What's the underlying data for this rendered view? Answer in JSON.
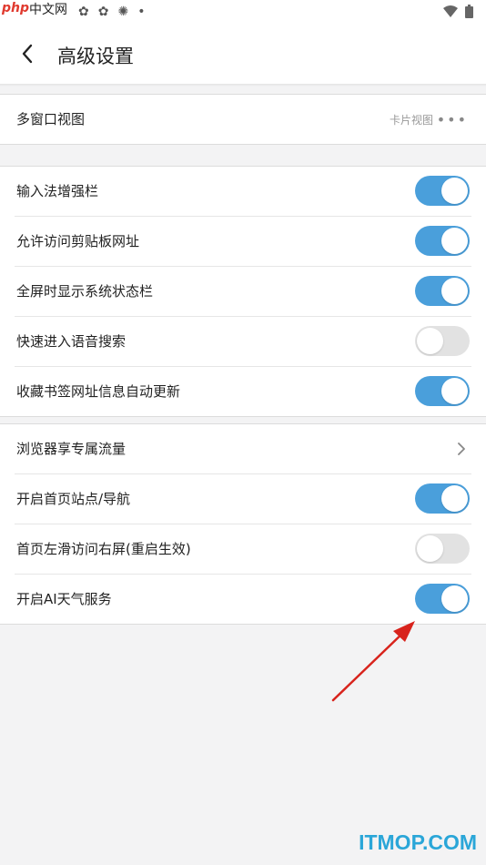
{
  "watermark": {
    "php": "php",
    "cn": "中文网",
    "bottom": "ITMOP.COM"
  },
  "header": {
    "title": "高级设置"
  },
  "section1": {
    "multi_window": {
      "label": "多窗口视图",
      "value": "卡片视图"
    }
  },
  "section2": {
    "items": [
      {
        "label": "输入法增强栏",
        "on": true
      },
      {
        "label": "允许访问剪贴板网址",
        "on": true
      },
      {
        "label": "全屏时显示系统状态栏",
        "on": true
      },
      {
        "label": "快速进入语音搜索",
        "on": false
      },
      {
        "label": "收藏书签网址信息自动更新",
        "on": true
      }
    ]
  },
  "section3": {
    "traffic": {
      "label": "浏览器享专属流量"
    },
    "items": [
      {
        "label": "开启首页站点/导航",
        "on": true
      },
      {
        "label": "首页左滑访问右屏(重启生效)",
        "on": false
      },
      {
        "label": "开启AI天气服务",
        "on": true
      }
    ]
  },
  "colors": {
    "toggle_on": "#4a9fdb",
    "toggle_off": "#e2e2e2",
    "arrow": "#d8231c"
  }
}
